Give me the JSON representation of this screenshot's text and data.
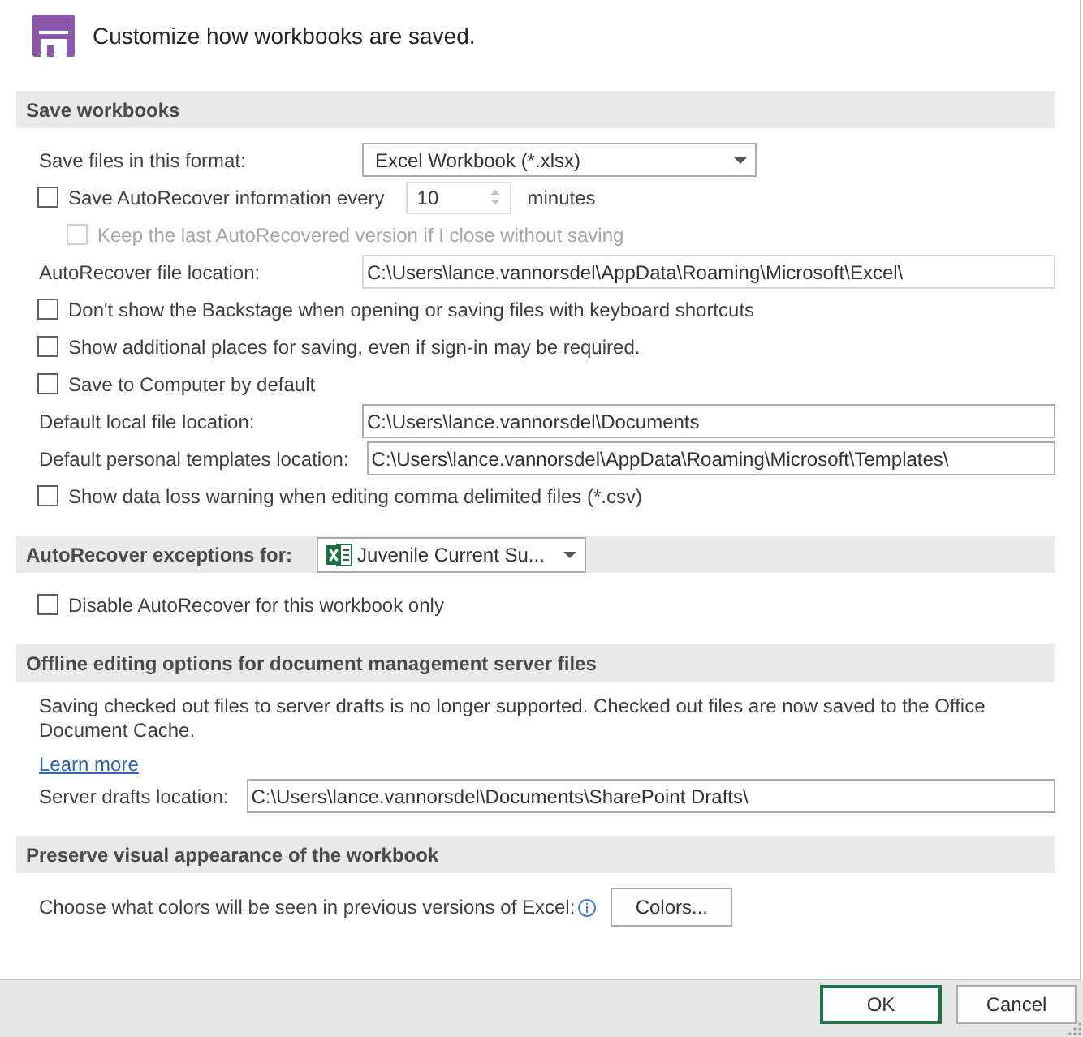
{
  "header": {
    "title": "Customize how workbooks are saved."
  },
  "sections": [
    {
      "title": "Save workbooks",
      "rows": [
        {
          "kind": "dropdown",
          "label": "Save files in this format:",
          "value": "Excel Workbook (*.xlsx)"
        },
        {
          "kind": "checkbox_spinner",
          "label": "Save AutoRecover information every",
          "checked": false,
          "disabled": false,
          "spinner": {
            "value": "10",
            "disabled": true
          },
          "unit": "minutes",
          "children": [
            {
              "kind": "checkbox",
              "label": "Keep the last AutoRecovered version if I close without saving",
              "checked": false,
              "disabled": true
            }
          ]
        },
        {
          "kind": "path_field",
          "label": "AutoRecover file location:",
          "value": "C:\\Users\\lance.vannorsdel\\AppData\\Roaming\\Microsoft\\Excel\\",
          "disabled": true
        },
        {
          "kind": "checkbox",
          "label": "Don't show the Backstage when opening or saving files with keyboard shortcuts",
          "checked": false,
          "disabled": false
        },
        {
          "kind": "checkbox",
          "label": "Show additional places for saving, even if sign-in may be required.",
          "checked": false,
          "disabled": false
        },
        {
          "kind": "checkbox",
          "label": "Save to Computer by default",
          "checked": false,
          "disabled": false
        },
        {
          "kind": "path_field",
          "label": "Default local file location:",
          "value": "C:\\Users\\lance.vannorsdel\\Documents",
          "disabled": false
        },
        {
          "kind": "path_field",
          "label": "Default personal templates location:",
          "value": "C:\\Users\\lance.vannorsdel\\AppData\\Roaming\\Microsoft\\Templates\\",
          "disabled": false
        },
        {
          "kind": "checkbox",
          "label": "Show data loss warning when editing comma delimited files (*.csv)",
          "checked": false,
          "disabled": false
        }
      ]
    },
    {
      "title": "AutoRecover exceptions for:",
      "workbook": {
        "name": "Juvenile Current Su..."
      },
      "rows": [
        {
          "kind": "checkbox",
          "label": "Disable AutoRecover for this workbook only",
          "checked": false,
          "disabled": false
        }
      ]
    },
    {
      "title": "Offline editing options for document management server files",
      "rows": [
        {
          "kind": "paragraph",
          "text": "Saving checked out files to server drafts is no longer supported. Checked out files are now saved to the Office Document Cache."
        },
        {
          "kind": "link",
          "text": "Learn more"
        },
        {
          "kind": "path_field",
          "label": "Server drafts location:",
          "value": "C:\\Users\\lance.vannorsdel\\Documents\\SharePoint Drafts\\",
          "disabled": false
        }
      ]
    },
    {
      "title": "Preserve visual appearance of the workbook",
      "rows": [
        {
          "kind": "button_row",
          "label": "Choose what colors will be seen in previous versions of Excel:",
          "button": "Colors..."
        }
      ]
    }
  ],
  "footer": {
    "buttons": [
      {
        "label": "OK",
        "default": true
      },
      {
        "label": "Cancel",
        "default": false
      }
    ]
  }
}
